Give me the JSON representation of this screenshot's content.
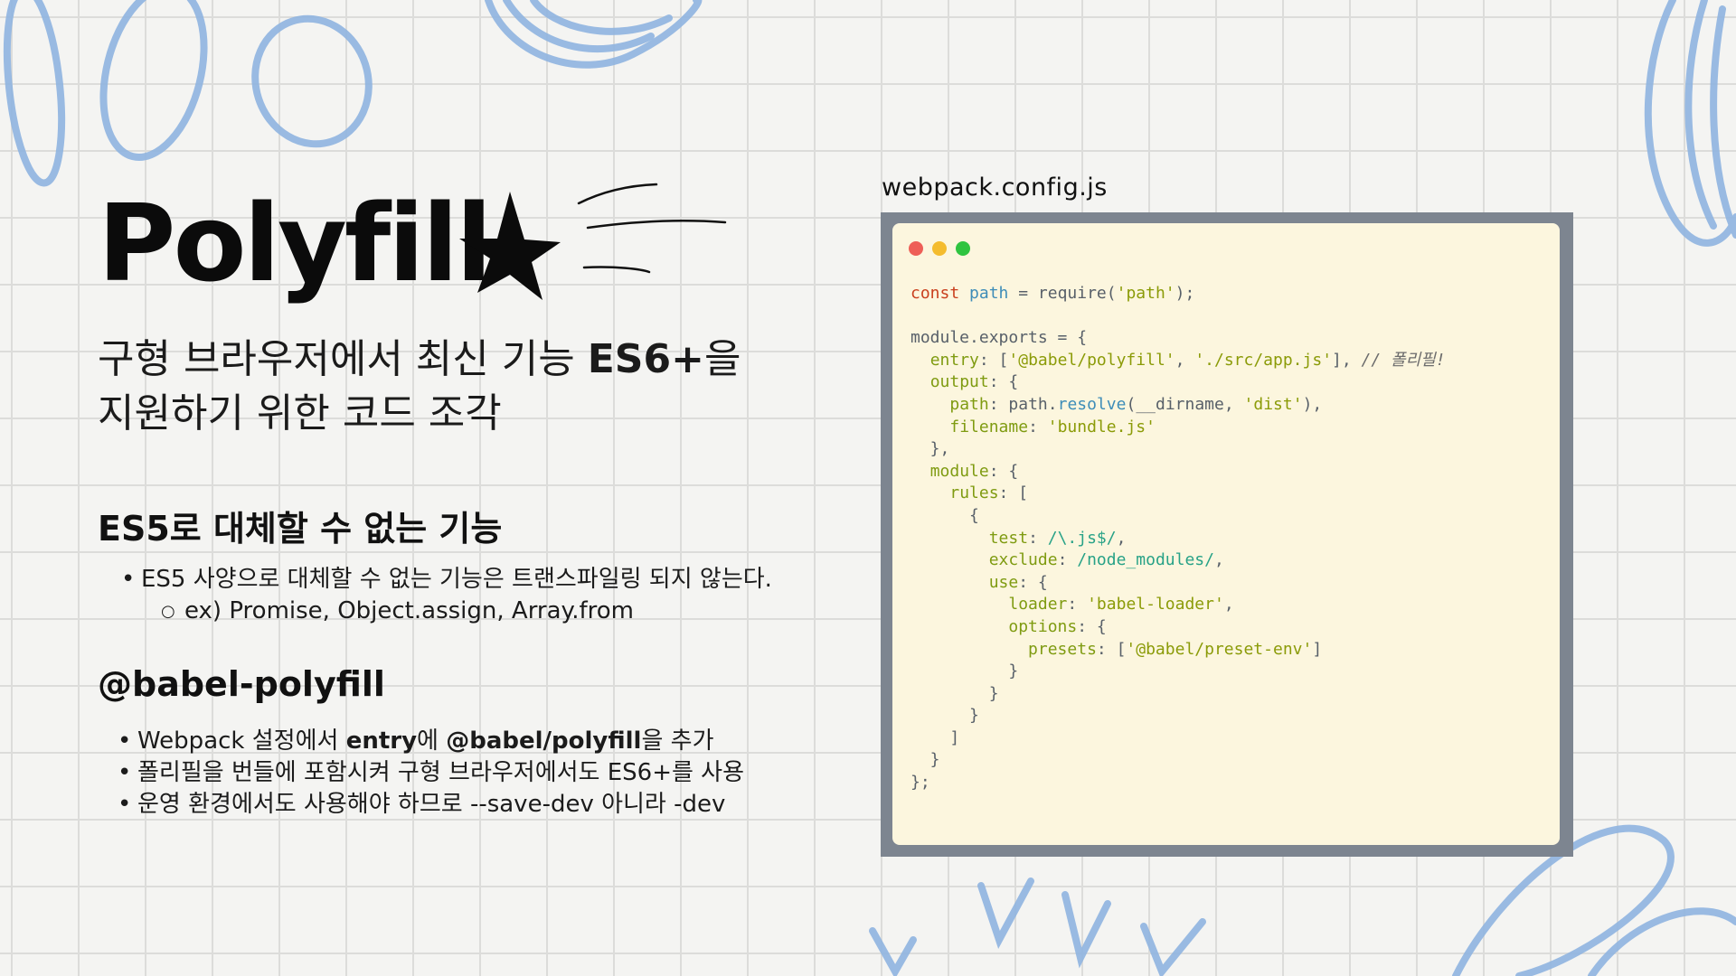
{
  "slide": {
    "title": "Polyfill",
    "subtitle_line1_prefix": "구형 브라우저에서 최신 기능 ",
    "subtitle_line1_bold": "ES6+",
    "subtitle_line1_suffix": "을",
    "subtitle_line2": "지원하기 위한 코드 조각"
  },
  "section_es5": {
    "heading": "ES5로 대체할 수 없는 기능",
    "bullet": "ES5 사양으로 대체할 수 없는 기능은 트랜스파일링 되지 않는다.",
    "sub_bullet": "ex) Promise, Object.assign, Array.from"
  },
  "section_babel": {
    "heading": "@babel-polyfill",
    "bullet1_a": "Webpack 설정에서 ",
    "bullet1_b": "entry",
    "bullet1_c": "에 ",
    "bullet1_d": "@babel/polyfill",
    "bullet1_e": "을 추가",
    "bullet2": "폴리필을 번들에 포함시켜 구형 브라우저에서도 ES6+를 사용",
    "bullet3": "운영 환경에서도 사용해야 하므로 --save-dev 아니라 -dev"
  },
  "code_panel": {
    "file_label": "webpack.config.js",
    "colors": {
      "background": "#fcf6de",
      "frame": "#7d8590",
      "keyword": "#c9401e",
      "string": "#8b9b08",
      "property": "#7f9b11"
    },
    "tokens": {
      "const": "const",
      "path": "path",
      "eq": " = ",
      "require": "require",
      "str_path": "'path'",
      "module_exports": "module.exports",
      "entry": "entry",
      "str_polyfill": "'@babel/polyfill'",
      "str_app": "'./src/app.js'",
      "comment": "// 폴리필!",
      "output": "output",
      "path_key": "path",
      "path_resolve": "path",
      "resolve": "resolve",
      "dirname": "__dirname",
      "str_dist": "'dist'",
      "filename": "filename",
      "str_bundle": "'bundle.js'",
      "module": "module",
      "rules": "rules",
      "test": "test",
      "regex_js": "/\\.js$/",
      "exclude": "exclude",
      "regex_nm": "/node_modules/",
      "use": "use",
      "loader": "loader",
      "str_loader": "'babel-loader'",
      "options": "options",
      "presets": "presets",
      "str_preset": "'@babel/preset-env'"
    }
  }
}
